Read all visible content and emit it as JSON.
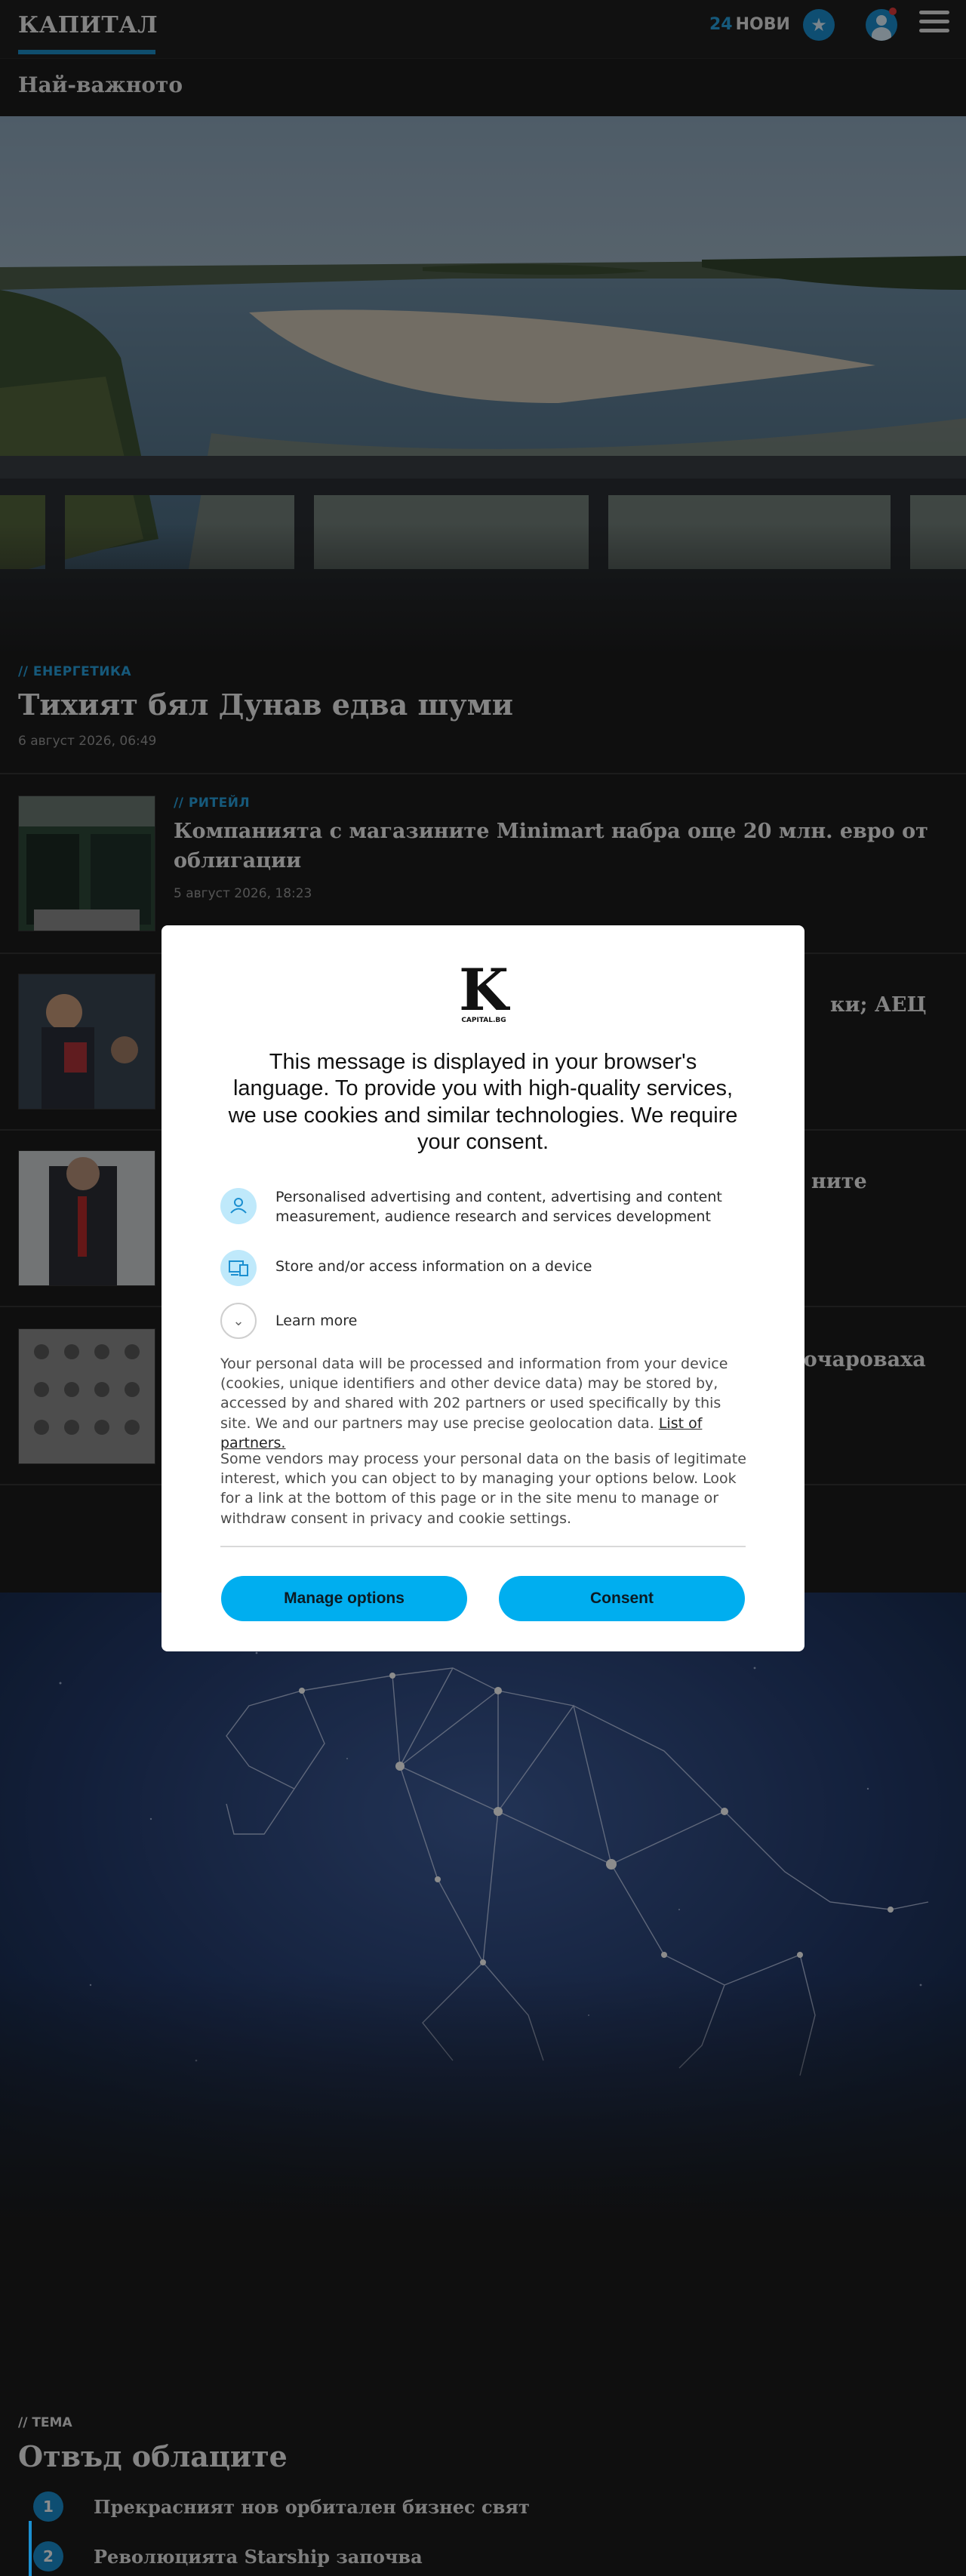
{
  "header": {
    "logo": "КАПИТАЛ",
    "news_count": "24",
    "news_label": "НОВИ"
  },
  "section": {
    "title": "Най-важното"
  },
  "lead_article": {
    "tag": "// ЕНЕРГЕТИКА",
    "title": "Тихият бял Дунав едва шуми",
    "date": "6 август 2026, 06:49"
  },
  "articles": [
    {
      "tag": "// РИТЕЙЛ",
      "title": "Компанията с магазините Minimart набра още 20 млн. евро от облигации",
      "date": "5 август 2026, 18:23"
    },
    {
      "title_visible": "ки; АЕЦ"
    },
    {
      "title_visible": "ните"
    },
    {
      "title_visible": "азочароваха"
    }
  ],
  "topic": {
    "tag": "// ТЕМА",
    "title": "Отвъд облаците",
    "items": [
      {
        "num": "1",
        "text": "Прекрасният нов орбитален бизнес свят"
      },
      {
        "num": "2",
        "text": "Революцията Starship започва"
      }
    ]
  },
  "consent": {
    "logo_letter": "K",
    "logo_sub": "CAPITAL.BG",
    "heading": "This message is displayed in your browser's language. To provide you with high-quality services, we use cookies and similar technologies. We require your consent.",
    "purposes": [
      {
        "icon": "person-icon",
        "text": "Personalised advertising and content, advertising and content measurement, audience research and services development"
      },
      {
        "icon": "devices-icon",
        "text": "Store and/or access information on a device"
      }
    ],
    "learn_more": "Learn more",
    "para1": "Your personal data will be processed and information from your device (cookies, unique identifiers and other device data) may be stored by, accessed by and shared with 202 partners or used specifically by this site. We and our partners may use precise geolocation data.",
    "partners_link": "List of partners.",
    "para2": "Some vendors may process your personal data on the basis of legitimate interest, which you can object to by managing your options below. Look for a link at the bottom of this page or in the site menu to manage or withdraw consent in privacy and cookie settings.",
    "manage_label": "Manage options",
    "consent_label": "Consent"
  },
  "colors": {
    "accent": "#1d8ec9",
    "button": "#00aeef",
    "background": "#1c1c1c"
  }
}
